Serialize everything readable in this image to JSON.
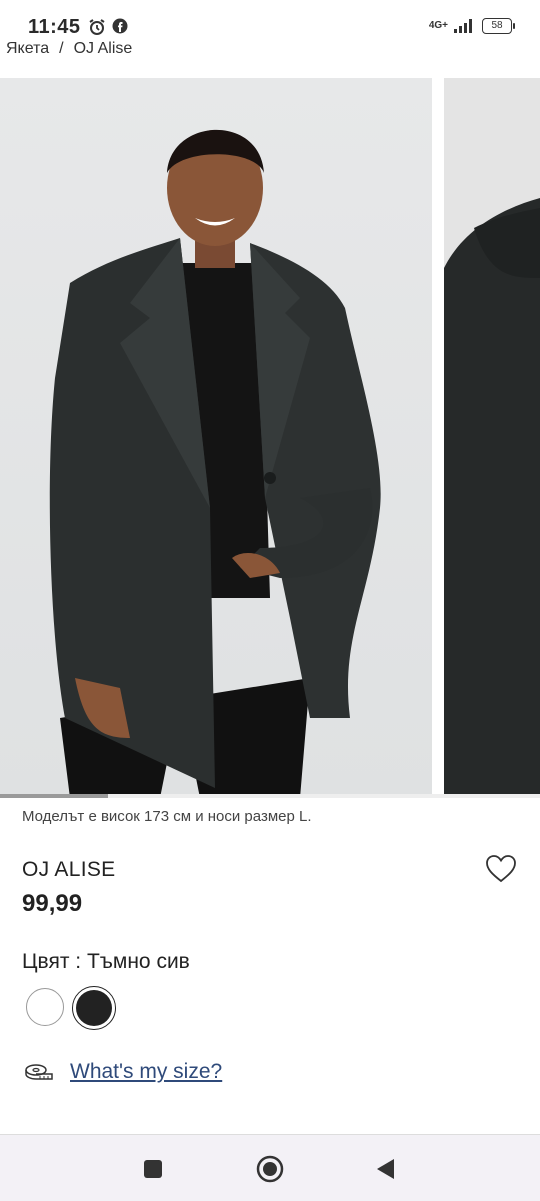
{
  "status_bar": {
    "time": "11:45",
    "network": "4G+",
    "battery": "58"
  },
  "breadcrumb": {
    "parent": "Якета",
    "separator": "/",
    "current": "OJ Alise"
  },
  "gallery": {
    "progress_fraction": 0.2
  },
  "product": {
    "model_info": "Моделът е висок 173 см и носи размер L.",
    "name": "OJ ALISE",
    "price": "99,99",
    "color_label": "Цвят : Тъмно сив",
    "colors": [
      {
        "name": "white",
        "hex": "#ffffff",
        "selected": false
      },
      {
        "name": "dark-grey",
        "hex": "#222222",
        "selected": true
      }
    ],
    "size_link": "What's my size?"
  },
  "colors": {
    "link": "#2f4a7a",
    "coat": "#2b2f2f",
    "background": "#e3e5e6"
  }
}
